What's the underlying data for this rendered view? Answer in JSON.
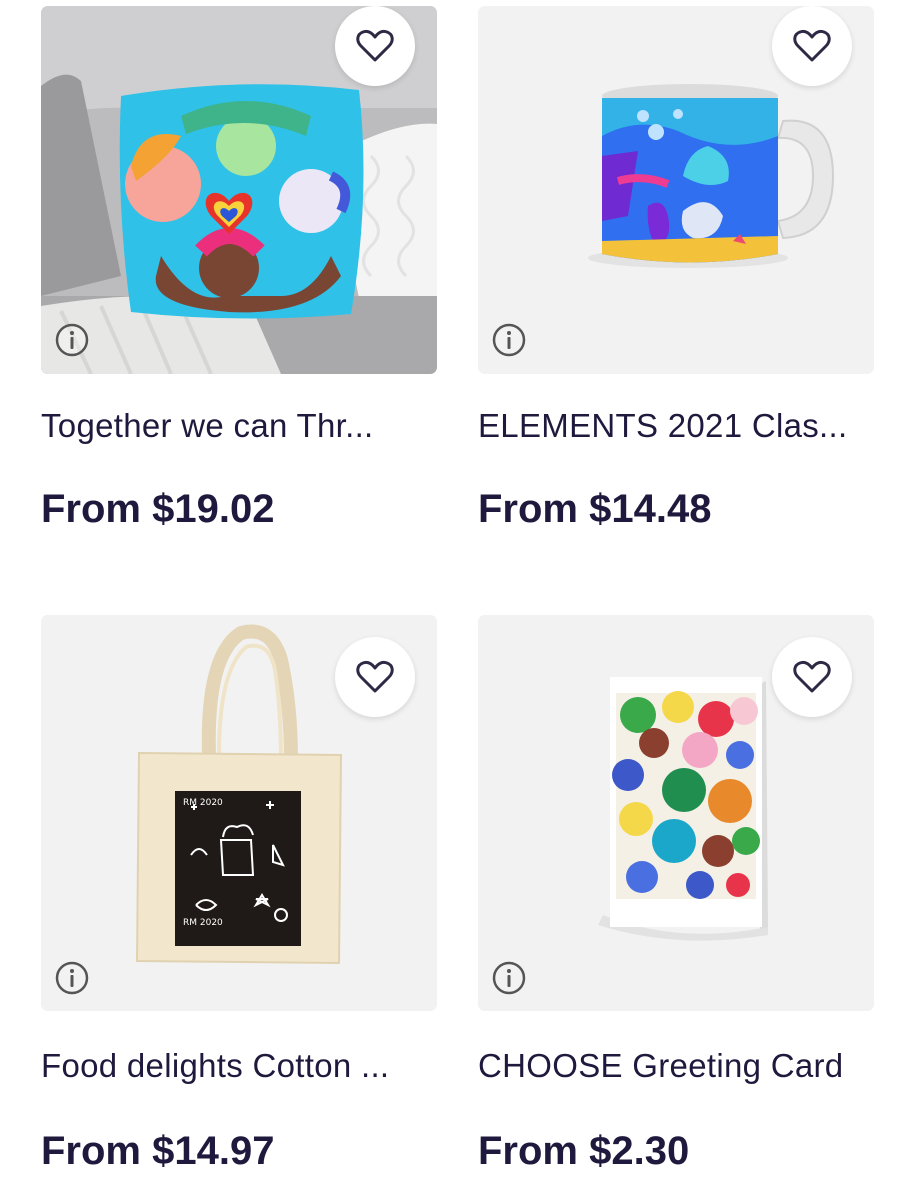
{
  "products": [
    {
      "title": "Together we can Thr...",
      "price": "From $19.02",
      "product": "throw-pillow"
    },
    {
      "title": "ELEMENTS 2021 Clas...",
      "price": "From $14.48",
      "product": "mug"
    },
    {
      "title": "Food delights Cotton ...",
      "price": "From $14.97",
      "product": "tote-bag"
    },
    {
      "title": "CHOOSE Greeting Card",
      "price": "From $2.30",
      "product": "greeting-card"
    }
  ],
  "icons": {
    "favorite": "heart-outline-icon",
    "info": "info-circle-icon"
  },
  "colors": {
    "text": "#1f1a3d",
    "card_bg": "#f2f2f2",
    "icon_stroke": "#2e2a45"
  }
}
